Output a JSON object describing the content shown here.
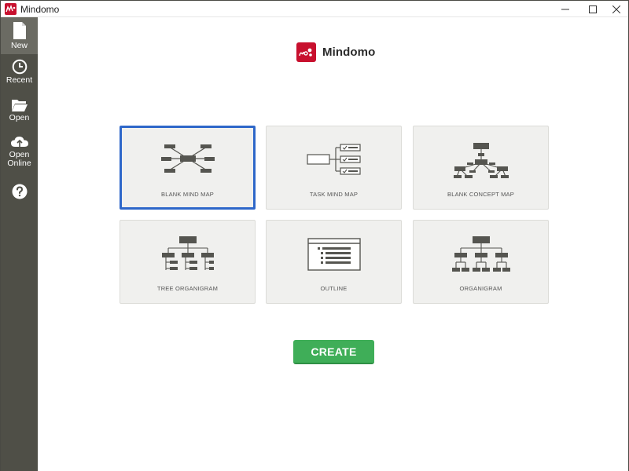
{
  "window": {
    "title": "Mindomo"
  },
  "sidebar": {
    "items": [
      {
        "label": "New",
        "icon": "new-file-icon"
      },
      {
        "label": "Recent",
        "icon": "clock-icon"
      },
      {
        "label": "Open",
        "icon": "folder-icon"
      },
      {
        "label": "Open Online",
        "icon": "cloud-icon"
      },
      {
        "label": "",
        "icon": "help-icon"
      }
    ]
  },
  "brand": {
    "name": "Mindomo"
  },
  "templates": [
    {
      "label": "BLANK MIND MAP",
      "selected": true
    },
    {
      "label": "TASK MIND MAP",
      "selected": false
    },
    {
      "label": "BLANK CONCEPT MAP",
      "selected": false
    },
    {
      "label": "TREE ORGANIGRAM",
      "selected": false
    },
    {
      "label": "OUTLINE",
      "selected": false
    },
    {
      "label": "ORGANIGRAM",
      "selected": false
    }
  ],
  "actions": {
    "create_label": "CREATE"
  },
  "colors": {
    "sidebar": "#4f4f47",
    "accent_red": "#c8102e",
    "selected_border": "#2e67c9",
    "create_green": "#3fae58",
    "card_bg": "#f0f0ee"
  }
}
